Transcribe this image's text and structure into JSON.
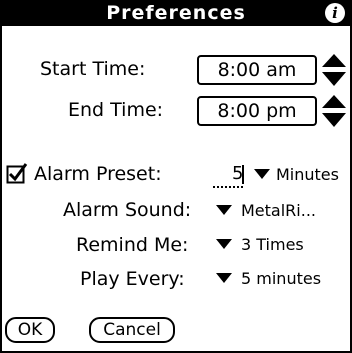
{
  "title": "Preferences",
  "info_icon": "info-icon",
  "start_time": {
    "label": "Start Time:",
    "value": "8:00 am"
  },
  "end_time": {
    "label": "End Time:",
    "value": "8:00 pm"
  },
  "alarm_preset": {
    "label": "Alarm Preset:",
    "value": "5",
    "unit": "Minutes",
    "checked": true
  },
  "alarm_sound": {
    "label": "Alarm Sound:",
    "value": "MetalRi..."
  },
  "remind_me": {
    "label": "Remind Me:",
    "value": "3 Times"
  },
  "play_every": {
    "label": "Play Every:",
    "value": "5 minutes"
  },
  "buttons": {
    "ok": "OK",
    "cancel": "Cancel"
  },
  "colors": {
    "titlebar": "#000000",
    "background": "#ffffff",
    "text": "#000000"
  }
}
